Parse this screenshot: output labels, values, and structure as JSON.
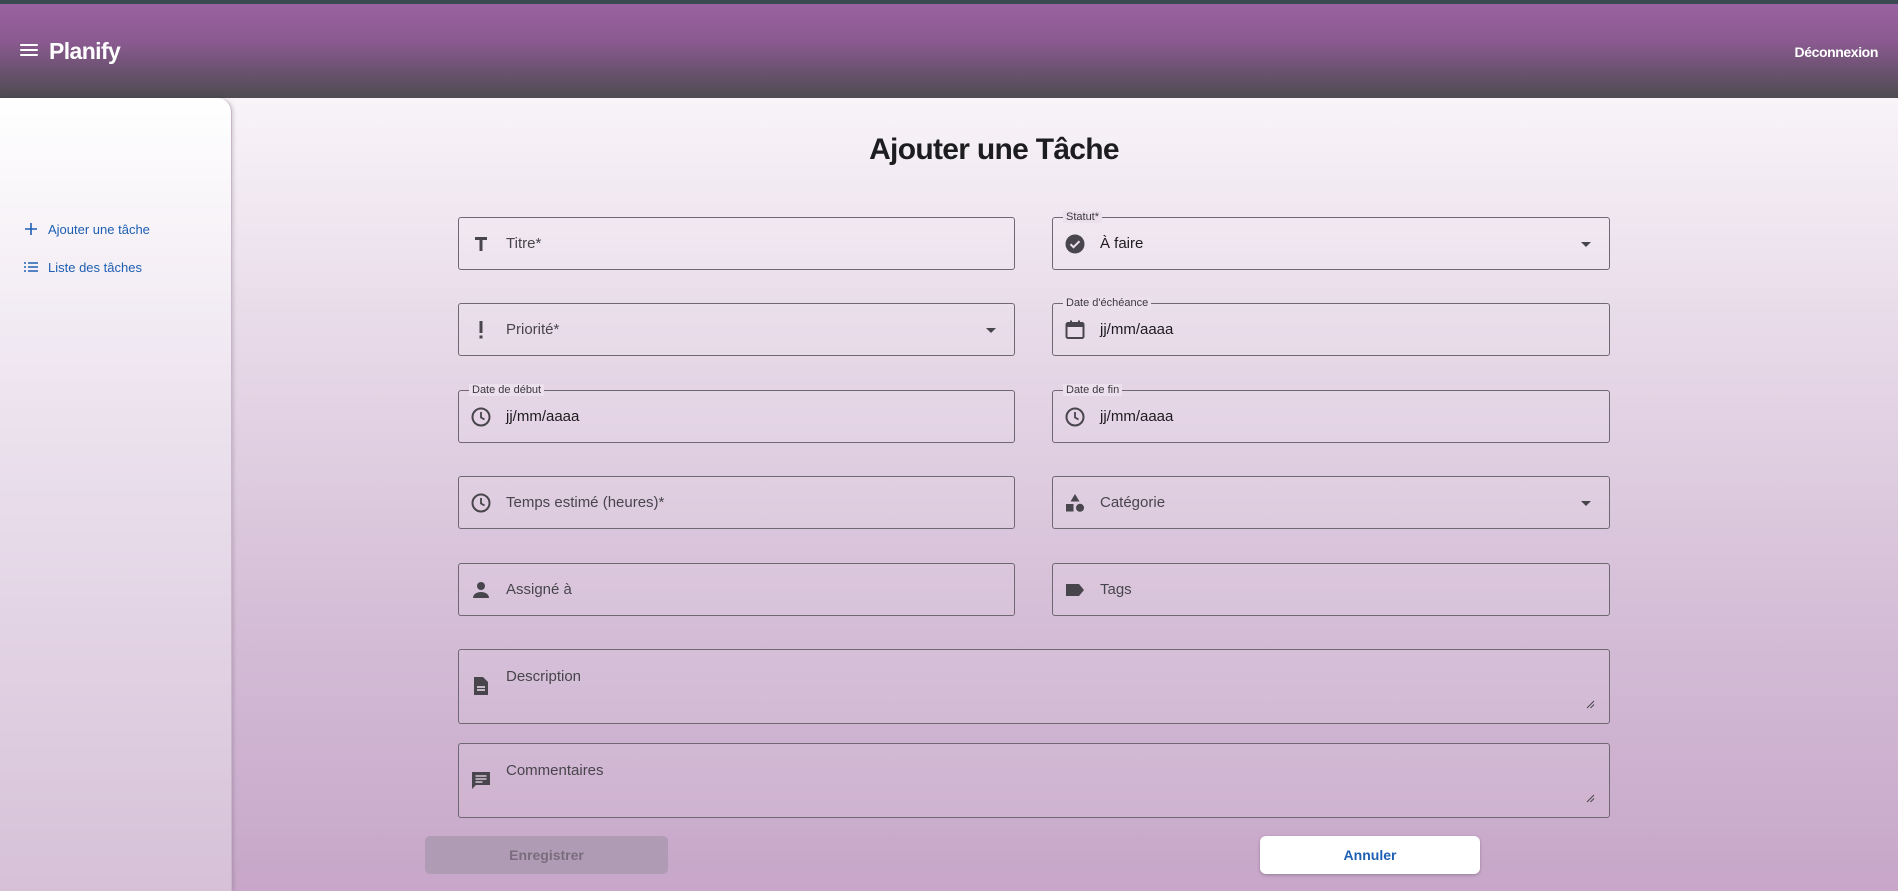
{
  "app": {
    "name": "Planify",
    "logout_label": "Déconnexion"
  },
  "sidebar": {
    "items": [
      {
        "label": "Ajouter une tâche",
        "icon": "plus-icon"
      },
      {
        "label": "Liste des tâches",
        "icon": "list-icon"
      }
    ]
  },
  "page": {
    "title": "Ajouter une Tâche"
  },
  "form": {
    "titre": {
      "placeholder": "Titre*",
      "icon": "title-t-icon"
    },
    "statut": {
      "label": "Statut*",
      "value": "À faire",
      "icon": "check-circle-icon"
    },
    "priorite": {
      "placeholder": "Priorité*",
      "icon": "exclamation-icon"
    },
    "date_echeance": {
      "label": "Date d'échéance",
      "value": "jj/mm/aaaa",
      "icon": "calendar-icon"
    },
    "date_debut": {
      "label": "Date de début",
      "value": "jj/mm/aaaa",
      "icon": "clock-icon"
    },
    "date_fin": {
      "label": "Date de fin",
      "value": "jj/mm/aaaa",
      "icon": "clock-icon"
    },
    "temps_estime": {
      "placeholder": "Temps estimé (heures)*",
      "icon": "clock-icon"
    },
    "categorie": {
      "placeholder": "Catégorie",
      "icon": "category-shapes-icon"
    },
    "assigne": {
      "placeholder": "Assigné à",
      "icon": "person-icon"
    },
    "tags": {
      "placeholder": "Tags",
      "icon": "label-tag-icon"
    },
    "description": {
      "placeholder": "Description",
      "icon": "document-icon"
    },
    "commentaires": {
      "placeholder": "Commentaires",
      "icon": "comment-icon"
    }
  },
  "buttons": {
    "save_label": "Enregistrer",
    "cancel_label": "Annuler"
  },
  "colors": {
    "accent": "#1e5fb3",
    "appbar_top": "#9a62a1",
    "appbar_bottom": "#4e4b52"
  }
}
